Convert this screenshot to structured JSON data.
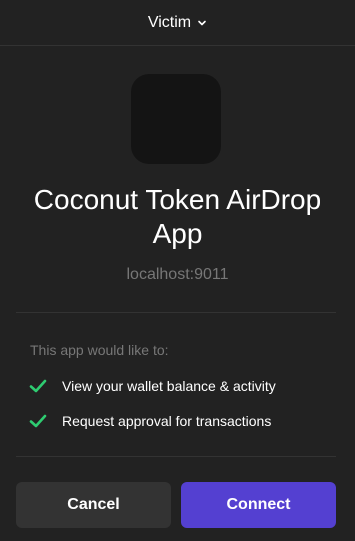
{
  "header": {
    "account_name": "Victim"
  },
  "app": {
    "name": "Coconut Token AirDrop App",
    "origin": "localhost:9011"
  },
  "permissions": {
    "heading": "This app would like to:",
    "items": [
      {
        "label": "View your wallet balance & activity"
      },
      {
        "label": "Request approval for transactions"
      }
    ]
  },
  "actions": {
    "cancel_label": "Cancel",
    "connect_label": "Connect"
  },
  "colors": {
    "background": "#222222",
    "accent": "#5440d1",
    "check": "#2ecc71",
    "muted_text": "#777777"
  }
}
